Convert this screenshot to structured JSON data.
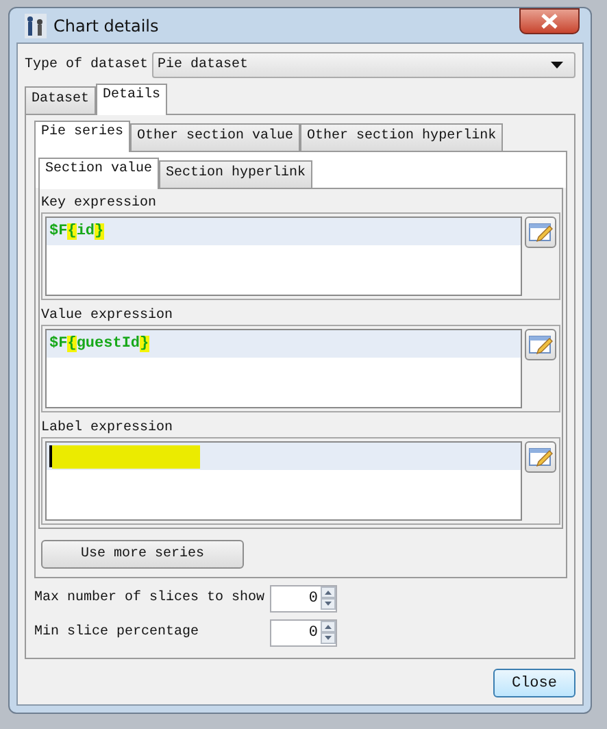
{
  "window": {
    "title": "Chart details"
  },
  "dataset_type": {
    "label": "Type of dataset",
    "value": "Pie dataset"
  },
  "tabs": [
    {
      "label": "Dataset",
      "selected": false
    },
    {
      "label": "Details",
      "selected": true
    }
  ],
  "series_tabs": [
    {
      "label": "Pie series",
      "selected": true
    },
    {
      "label": "Other section value",
      "selected": false
    },
    {
      "label": "Other section hyperlink",
      "selected": false
    }
  ],
  "section_tabs": [
    {
      "label": "Section value",
      "selected": true
    },
    {
      "label": "Section hyperlink",
      "selected": false
    }
  ],
  "expressions": [
    {
      "label": "Key expression",
      "value": "$F{id}",
      "redacted": false,
      "focused": false
    },
    {
      "label": "Value expression",
      "value": "$F{guestId}",
      "redacted": false,
      "focused": false
    },
    {
      "label": "Label expression",
      "redacted": true,
      "focused": true
    }
  ],
  "more_series_button": "Use more series",
  "spinners": [
    {
      "label": "Max number of slices to show",
      "value": "0"
    },
    {
      "label": "Min slice percentage",
      "value": "0"
    }
  ],
  "buttons": [
    "Close"
  ]
}
